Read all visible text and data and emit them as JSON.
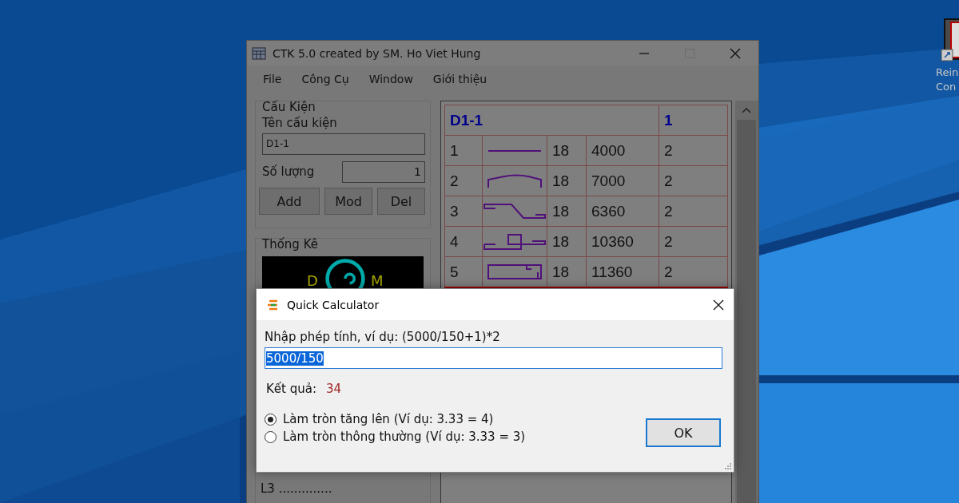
{
  "desktop_icons": [
    {
      "label_lines": [
        "Rein",
        "Con"
      ]
    }
  ],
  "main_window": {
    "title": "CTK 5.0 created by SM. Ho Viet Hung",
    "disabled": true,
    "menu": [
      "File",
      "Công Cụ",
      "Window",
      "Giới thiệu"
    ],
    "component_group": {
      "title": "Cấu Kiện",
      "name_label": "Tên cấu kiện",
      "name_value": "D1-1",
      "qty_label": "Số lượng",
      "qty_value": "1",
      "buttons": [
        "Add",
        "Mod",
        "Del"
      ]
    },
    "stats_group": {
      "title": "Thống Kê",
      "preview_letters": [
        "D",
        "M"
      ],
      "lines": [
        "L3 .............."
      ]
    },
    "table": {
      "title": "D1-1",
      "count": "1",
      "rows": [
        {
          "no": "1",
          "kind": "straight",
          "diameter": "18",
          "length": "4000",
          "qty": "2"
        },
        {
          "no": "2",
          "kind": "arch",
          "diameter": "18",
          "length": "7000",
          "qty": "2"
        },
        {
          "no": "3",
          "kind": "crank",
          "diameter": "18",
          "length": "6360",
          "qty": "2"
        },
        {
          "no": "4",
          "kind": "loop",
          "diameter": "18",
          "length": "10360",
          "qty": "2"
        },
        {
          "no": "5",
          "kind": "stirrup",
          "diameter": "18",
          "length": "11360",
          "qty": "2"
        }
      ]
    }
  },
  "dialog": {
    "title": "Quick Calculator",
    "prompt": "Nhập phép tính, ví dụ: (5000/150+1)*2",
    "expression": "5000/150",
    "result_label": "Kết quả:",
    "result": "34",
    "options": [
      {
        "label": "Làm tròn tăng lên (Ví dụ: 3.33 = 4)",
        "selected": true
      },
      {
        "label": "Làm tròn thông thường (Ví dụ: 3.33 = 3)",
        "selected": false
      }
    ],
    "ok_button": "OK"
  }
}
